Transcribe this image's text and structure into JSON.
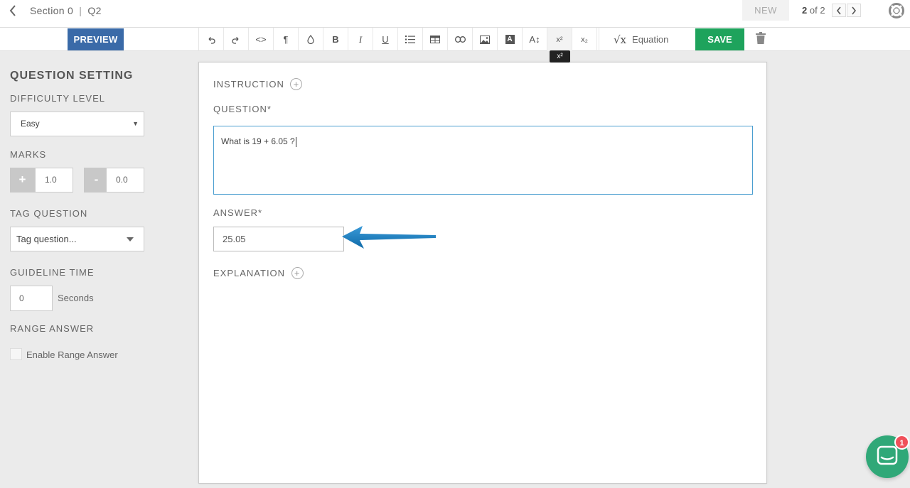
{
  "header": {
    "section": "Section 0",
    "separator": "|",
    "question_id": "Q2",
    "new_label": "NEW",
    "pager_current": "2",
    "pager_of": "of 2"
  },
  "toolbar": {
    "preview_label": "PREVIEW",
    "tools": [
      {
        "name": "undo-icon",
        "label": ""
      },
      {
        "name": "redo-icon",
        "label": ""
      },
      {
        "name": "code-view-icon",
        "label": "<>"
      },
      {
        "name": "paragraph-icon",
        "label": "¶"
      },
      {
        "name": "color-drop-icon",
        "label": ""
      },
      {
        "name": "bold-icon",
        "label": "B"
      },
      {
        "name": "italic-icon",
        "label": "I"
      },
      {
        "name": "underline-icon",
        "label": "U"
      },
      {
        "name": "list-icon",
        "label": ""
      },
      {
        "name": "table-icon",
        "label": ""
      },
      {
        "name": "link-icon",
        "label": ""
      },
      {
        "name": "image-icon",
        "label": ""
      },
      {
        "name": "text-color-icon",
        "label": "A"
      },
      {
        "name": "font-size-icon",
        "label": "A↕"
      },
      {
        "name": "superscript-icon",
        "label": "x²"
      },
      {
        "name": "subscript-icon",
        "label": "x₂"
      }
    ],
    "equation_label": "Equation",
    "save_label": "SAVE",
    "tooltip": "x²"
  },
  "sidebar": {
    "title": "QUESTION SETTING",
    "difficulty_label": "DIFFICULTY LEVEL",
    "difficulty_value": "Easy",
    "marks_label": "MARKS",
    "plus_label": "+",
    "plus_value": "1.0",
    "minus_label": "-",
    "minus_value": "0.0",
    "tag_label": "TAG QUESTION",
    "tag_placeholder": "Tag question...",
    "guideline_label": "GUIDELINE TIME",
    "guideline_value": "0",
    "guideline_unit": "Seconds",
    "range_label": "RANGE ANSWER",
    "range_checkbox_label": "Enable Range Answer"
  },
  "editor": {
    "instruction_label": "INSTRUCTION",
    "question_label": "QUESTION*",
    "question_text": "What is 19 + 6.05 ?",
    "answer_label": "ANSWER*",
    "answer_value": "25.05",
    "explanation_label": "EXPLANATION"
  },
  "chat": {
    "badge_count": "1"
  },
  "colors": {
    "preview": "#3a6aa8",
    "save": "#1ea35c",
    "focus_border": "#4a9ed0",
    "arrow": "#1a7fc0",
    "chat": "#30a878",
    "badge": "#f0505a"
  }
}
